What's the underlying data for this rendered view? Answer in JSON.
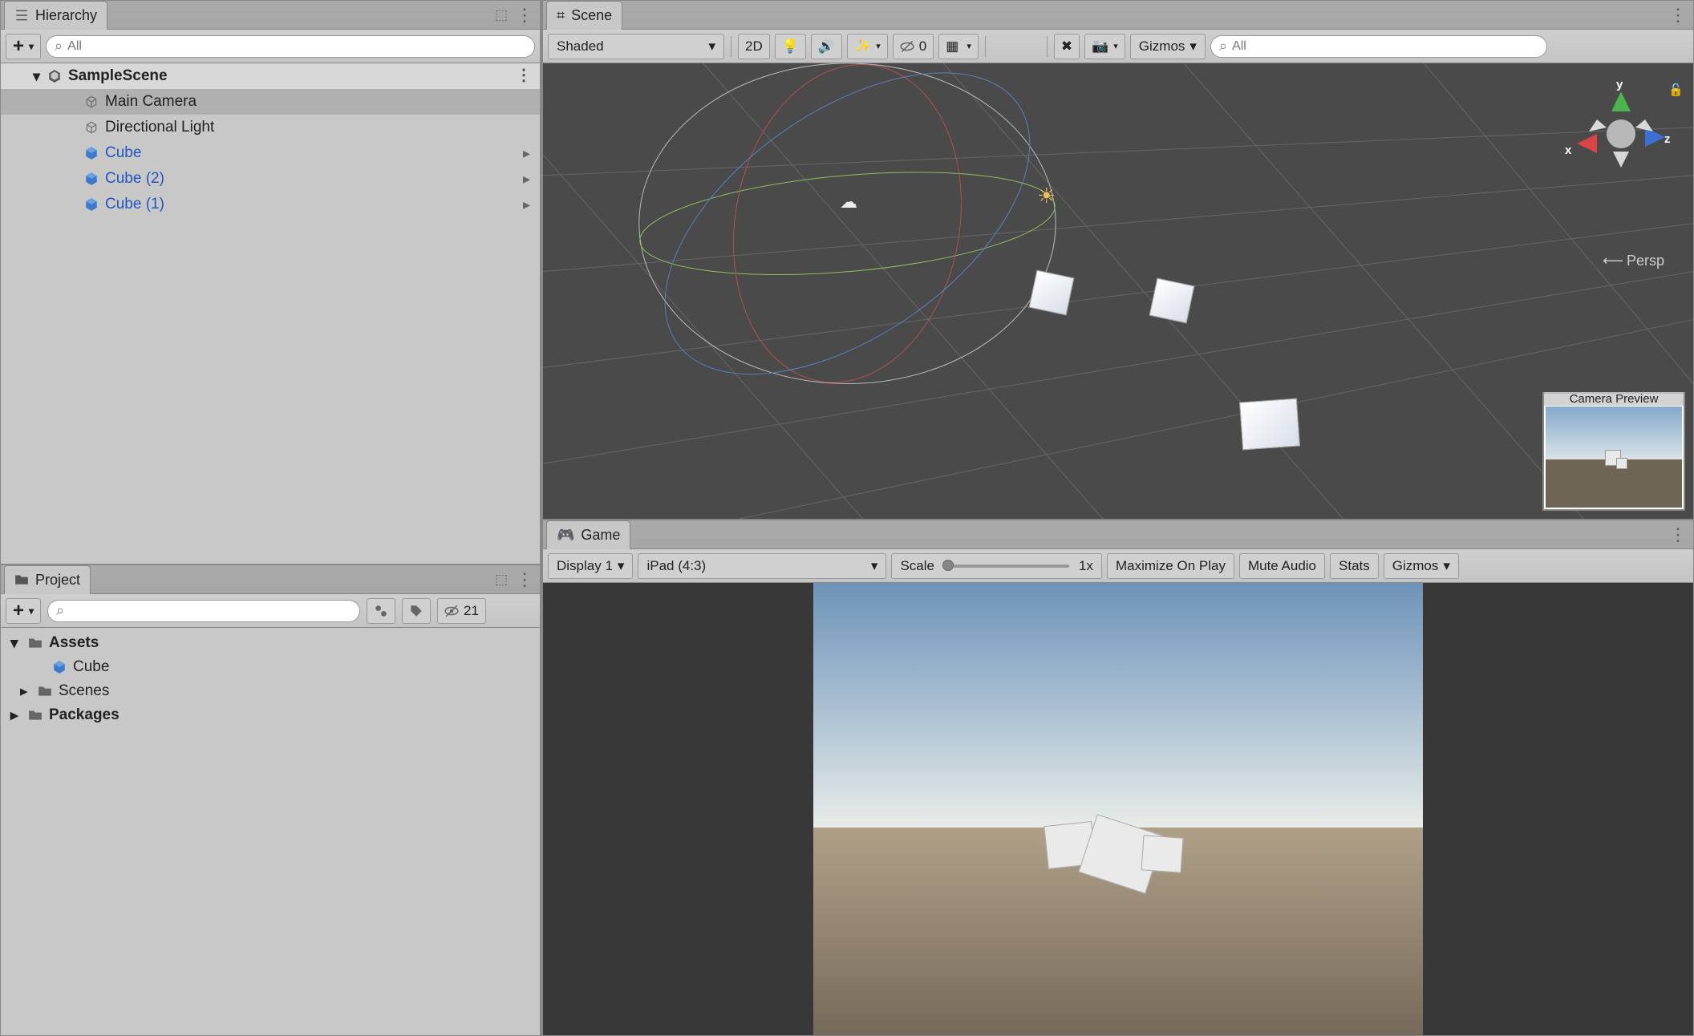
{
  "hierarchy": {
    "title": "Hierarchy",
    "search_placeholder": "All",
    "scene": "SampleScene",
    "items": [
      {
        "label": "Main Camera",
        "selected": true,
        "kind": "camera"
      },
      {
        "label": "Directional Light",
        "selected": false,
        "kind": "light"
      },
      {
        "label": "Cube",
        "selected": false,
        "kind": "prefab",
        "expandable": true
      },
      {
        "label": "Cube (2)",
        "selected": false,
        "kind": "prefab",
        "expandable": true
      },
      {
        "label": "Cube (1)",
        "selected": false,
        "kind": "prefab",
        "expandable": true
      }
    ]
  },
  "project": {
    "title": "Project",
    "visibility_count": "21",
    "search_placeholder": "",
    "root": [
      {
        "label": "Assets",
        "bold": true,
        "icon": "folder",
        "indent": 0,
        "caret": "down"
      },
      {
        "label": "Cube",
        "bold": false,
        "icon": "cube",
        "indent": 1
      },
      {
        "label": "Scenes",
        "bold": false,
        "icon": "folder",
        "indent": 1,
        "caret": "right"
      },
      {
        "label": "Packages",
        "bold": true,
        "icon": "folder",
        "indent": 0,
        "caret": "right"
      }
    ]
  },
  "scene": {
    "tab": "Scene",
    "shading": "Shaded",
    "btn_2d": "2D",
    "hidden_count": "0",
    "gizmos_label": "Gizmos",
    "search_placeholder": "All",
    "camera_preview_title": "Camera Preview",
    "gizmo_axes": {
      "x": "x",
      "y": "y",
      "z": "z"
    },
    "persp_label": "Persp"
  },
  "game": {
    "tab": "Game",
    "display": "Display 1",
    "aspect": "iPad (4:3)",
    "scale_label": "Scale",
    "scale_value": "1x",
    "maximize": "Maximize On Play",
    "mute": "Mute Audio",
    "stats": "Stats",
    "gizmos": "Gizmos"
  },
  "icons": {
    "lock": "🔒",
    "menu": "⋮",
    "add": "+",
    "dropdown": "▾",
    "caret_right": "▸",
    "caret_down": "▾",
    "search": "🔍",
    "eye": "👁"
  }
}
